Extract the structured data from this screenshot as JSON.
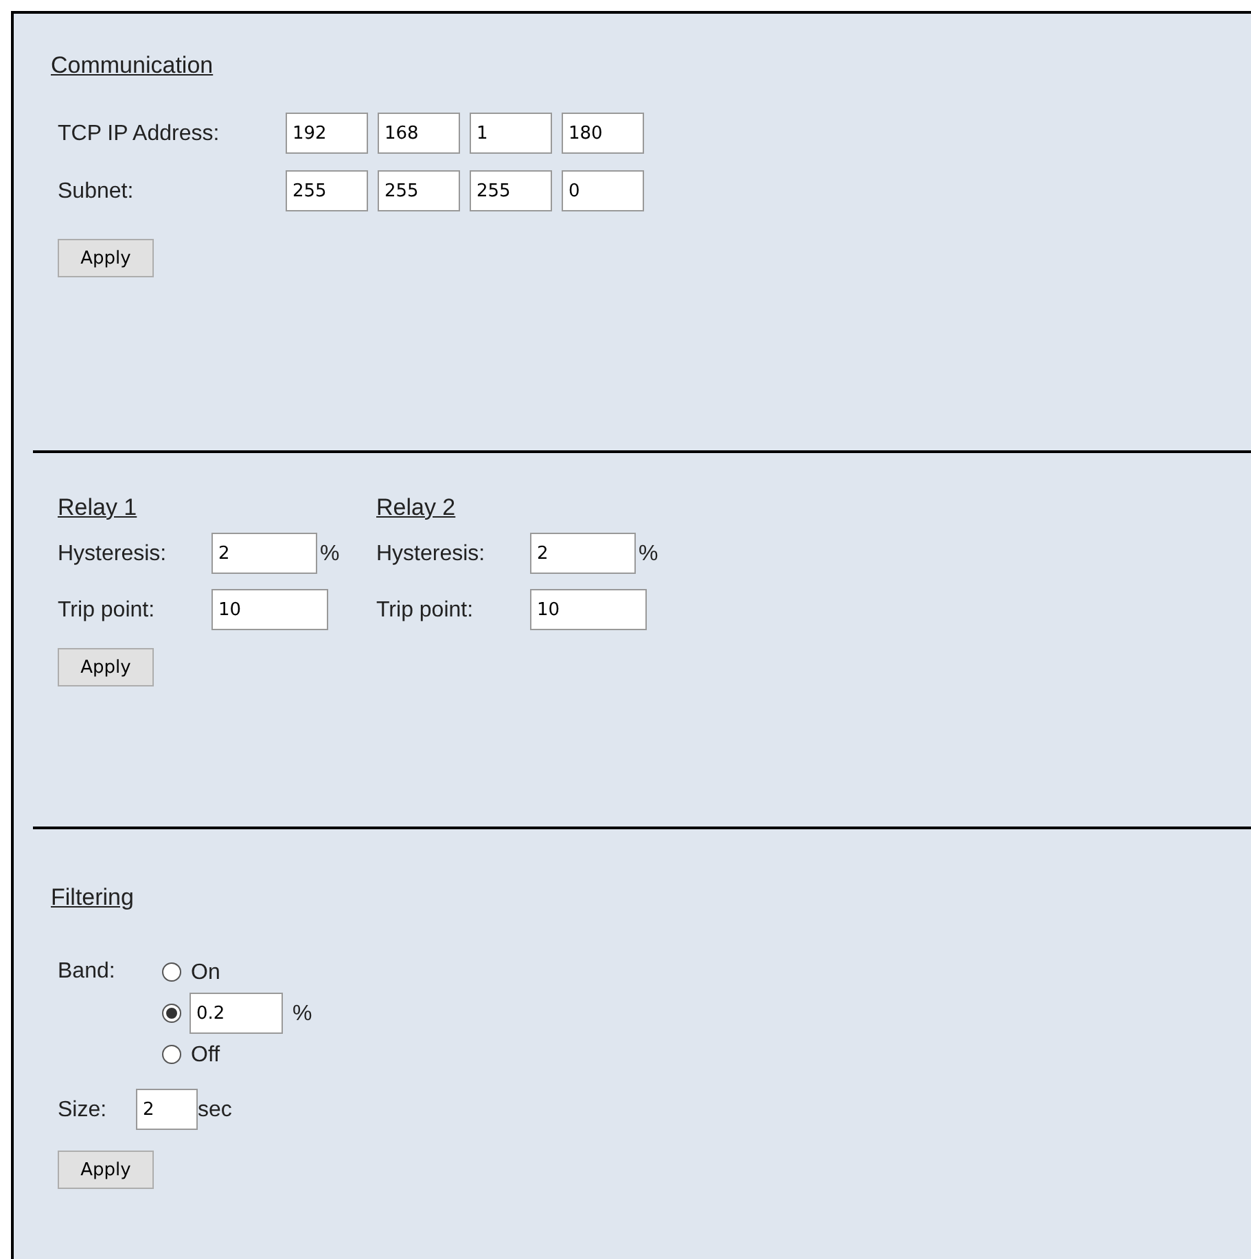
{
  "communication": {
    "title": "Communication",
    "rows": [
      {
        "label": "TCP IP Address:",
        "octets": [
          "192",
          "168",
          "1",
          "180"
        ]
      },
      {
        "label": "Subnet:",
        "octets": [
          "255",
          "255",
          "255",
          "0"
        ]
      }
    ],
    "apply": "Apply"
  },
  "relays": [
    {
      "title": "Relay 1",
      "hysteresis_label": "Hysteresis:",
      "hysteresis": "2",
      "hysteresis_unit": "%",
      "trip_label": "Trip point:",
      "trip": "10"
    },
    {
      "title": "Relay 2",
      "hysteresis_label": "Hysteresis:",
      "hysteresis": "2",
      "hysteresis_unit": "%",
      "trip_label": "Trip point:",
      "trip": "10"
    }
  ],
  "relay_apply": "Apply",
  "filtering": {
    "title": "Filtering",
    "band_label": "Band:",
    "options": [
      {
        "kind": "label",
        "label": "On",
        "selected": false
      },
      {
        "kind": "field",
        "value": "0.2",
        "unit": "%",
        "selected": true
      },
      {
        "kind": "label",
        "label": "Off",
        "selected": false
      }
    ],
    "size_label": "Size:",
    "size": "2",
    "size_unit": "sec",
    "apply": "Apply"
  }
}
